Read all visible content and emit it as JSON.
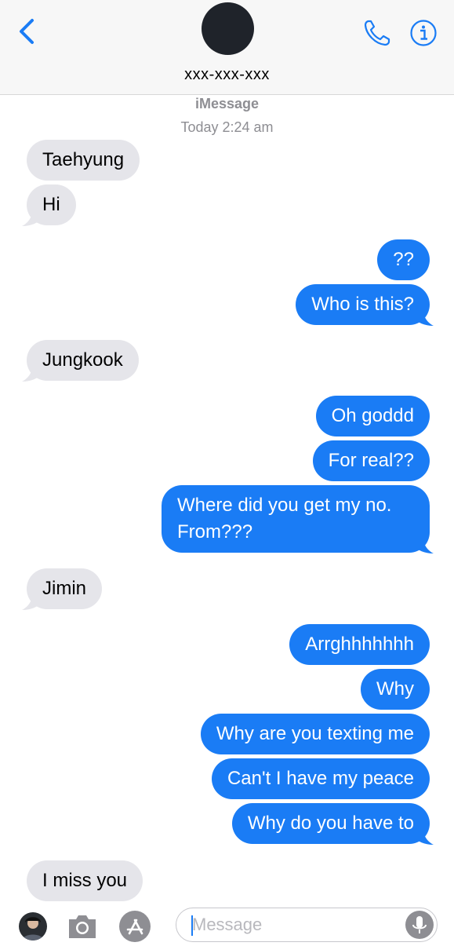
{
  "header": {
    "contact_number": "xxx-xxx-xxx",
    "icons": {
      "back": "chevron-left-icon",
      "phone": "phone-icon",
      "info": "info-icon"
    }
  },
  "thread": {
    "service_label": "iMessage",
    "timestamp": "Today 2:24 am"
  },
  "messages": [
    {
      "direction": "incoming",
      "text": "Taehyung"
    },
    {
      "direction": "incoming",
      "text": "Hi"
    },
    {
      "direction": "outgoing",
      "text": "??"
    },
    {
      "direction": "outgoing",
      "text": "Who is this?"
    },
    {
      "direction": "incoming",
      "text": "Jungkook"
    },
    {
      "direction": "outgoing",
      "text": "Oh goddd"
    },
    {
      "direction": "outgoing",
      "text": "For real??"
    },
    {
      "direction": "outgoing",
      "text": "Where did you get my no. From???"
    },
    {
      "direction": "incoming",
      "text": "Jimin"
    },
    {
      "direction": "outgoing",
      "text": "Arrghhhhhhh"
    },
    {
      "direction": "outgoing",
      "text": "Why"
    },
    {
      "direction": "outgoing",
      "text": "Why are you texting me"
    },
    {
      "direction": "outgoing",
      "text": "Can't I have my peace"
    },
    {
      "direction": "outgoing",
      "text": "Why do you have to"
    },
    {
      "direction": "incoming",
      "text": "I miss you"
    }
  ],
  "composer": {
    "placeholder": "Message",
    "icons": {
      "camera": "camera-icon",
      "app_store": "app-store-icon",
      "mic": "microphone-icon"
    }
  },
  "colors": {
    "outgoing_bubble": "#1a7cf5",
    "incoming_bubble": "#e5e5ea",
    "accent": "#1a7cf5"
  }
}
